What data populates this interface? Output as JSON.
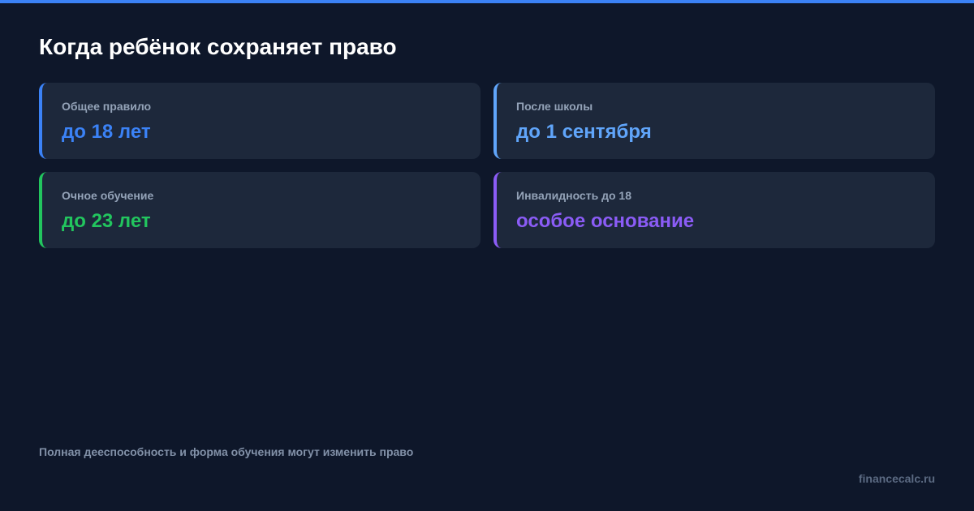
{
  "header": {
    "title": "Когда ребёнок сохраняет право"
  },
  "colors": {
    "background": "#0e172a",
    "card_background": "#1d283b",
    "top_bar": "#3b82f6"
  },
  "cards": [
    {
      "label": "Общее правило",
      "value": "до 18 лет",
      "accent": "#3b82f6"
    },
    {
      "label": "После школы",
      "value": "до 1 сентября",
      "accent": "#60a5fa"
    },
    {
      "label": "Очное обучение",
      "value": "до 23 лет",
      "accent": "#22c55e"
    },
    {
      "label": "Инвалидность до 18",
      "value": "особое основание",
      "accent": "#8b5cf6"
    }
  ],
  "footer": {
    "note": "Полная дееспособность и форма обучения могут изменить право",
    "brand": "financecalc.ru"
  }
}
